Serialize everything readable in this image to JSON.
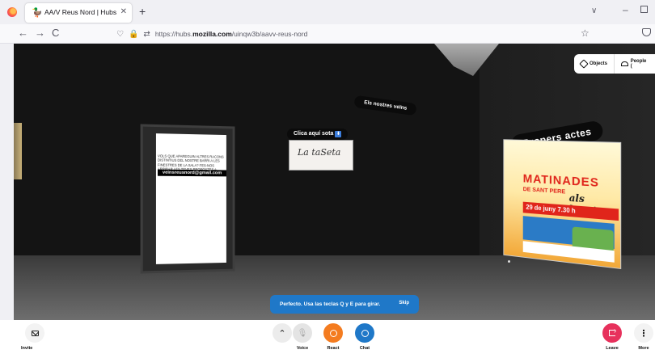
{
  "browser": {
    "tab_title": "AA/V Reus Nord | Hubs by Mozi",
    "tab_close": "✕",
    "new_tab": "+",
    "url_prefix": "https://hubs.",
    "url_domain": "mozilla.com",
    "url_rest": "/uinqw3b/aavv-reus-nord",
    "back": "←",
    "forward": "→",
    "reload": "C",
    "star": "☆",
    "tab_list": "∨",
    "minimize": "–"
  },
  "scene": {
    "poster_text": "VOLS QUE APAREGUIN ALTRES RACONS DISTINTIUS DEL NOSTRE BARRI A LES FINESTRES DE LA SALA? FES-NOS ARRIBAR LES TEVES PROPOSTES A",
    "poster_email": "veinsreusnord@gmail.com",
    "veins_label": "Els nostres veïns",
    "clica_label": "Clica aquí sota",
    "clica_emoji": "⬇",
    "latalta_text": "La taSeta",
    "propers_label": "Propers actes",
    "matinades_title": "MATINADES",
    "matinades_sub": "DE SANT PERE",
    "matinades_barris": "als barris",
    "matinades_date": "29 de juny 7.30 h",
    "objects_label": "Objects",
    "people_label": "People ("
  },
  "toast": {
    "message": "Perfecto. Usa las teclas Q y E para girar.",
    "skip": "Skip"
  },
  "toolbar": {
    "invite": "Invite",
    "voice": "Voice",
    "react": "React",
    "chat": "Chat",
    "leave": "Leave",
    "more": "More",
    "chevron": "⌃",
    "more_glyph": "⋮"
  },
  "icons": [
    "firefox-logo-icon",
    "hubs-favicon-icon",
    "shield-icon",
    "lock-icon",
    "permissions-icon",
    "star-icon",
    "pocket-icon",
    "objects-icon",
    "people-icon",
    "envelope-icon",
    "chevron-up-icon",
    "mic-muted-icon",
    "smiley-icon",
    "chat-bubble-icon",
    "leave-icon",
    "kebab-icon"
  ],
  "colors": {
    "toast": "#1f78c8",
    "react": "#f47c20",
    "chat": "#1f78c8",
    "leave": "#e7315c"
  }
}
